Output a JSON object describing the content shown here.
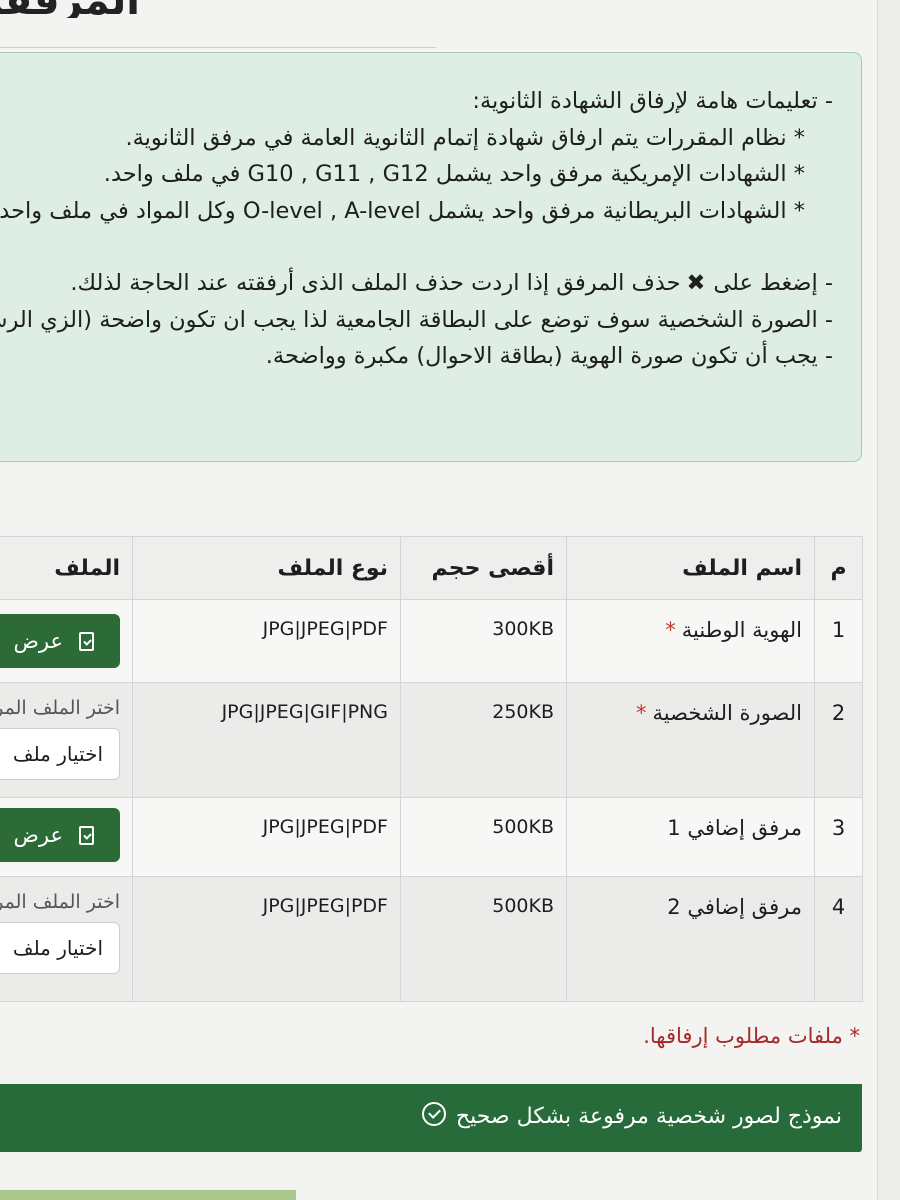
{
  "page": {
    "heading": "المرفقات"
  },
  "instructions": {
    "lines": [
      "- تعليمات هامة لإرفاق الشهادة الثانوية:",
      "* نظام المقررات يتم ارفاق شهادة إتمام الثانوية العامة في مرفق الثانوية.",
      "* الشهادات الإمريكية مرفق واحد يشمل G10 , G11 , G12 في ملف واحد.",
      "* الشهادات البريطانية مرفق واحد يشمل O-level , A-level وكل المواد في ملف واحد."
    ],
    "delete_prefix": "- إضغط على",
    "delete_text": "حذف المرفق إذا اردت حذف الملف الذى أرفقته عند الحاجة لذلك.",
    "photo_note": "- الصورة الشخصية سوف توضع على البطاقة الجامعية لذا يجب ان تكون واضحة (الزي الرسمي).",
    "id_note": "- يجب أن تكون صورة الهوية (بطاقة الاحوال) مكبرة وواضحة."
  },
  "table": {
    "headers": {
      "num": "م",
      "name": "اسم الملف",
      "max_size": "أقصى حجم",
      "type": "نوع الملف",
      "file": "الملف"
    },
    "rows": [
      {
        "num": "1",
        "name": "الهوية الوطنية",
        "required": "*",
        "max_size": "300KB",
        "type": "JPG|JPEG|PDF",
        "action": "عرض"
      },
      {
        "num": "2",
        "name": "الصورة الشخصية",
        "required": "*",
        "max_size": "250KB",
        "type": "JPG|JPEG|GIF|PNG",
        "choose_label": "اختر الملف المراد ارفاقه",
        "choose_button": "اختيار ملف"
      },
      {
        "num": "3",
        "name": "مرفق إضافي 1",
        "max_size": "500KB",
        "type": "JPG|JPEG|PDF",
        "action": "عرض"
      },
      {
        "num": "4",
        "name": "مرفق إضافي 2",
        "max_size": "500KB",
        "type": "JPG|JPEG|PDF",
        "choose_label": "اختر الملف المراد ارفاقه",
        "choose_button": "اختيار ملف"
      }
    ]
  },
  "required_note": "* ملفات مطلوب إرفاقها.",
  "sample_link": "نموذج لصور شخصية مرفوعة بشكل صحيح",
  "icons": {
    "delete": "close-x-icon",
    "view": "document-check-icon",
    "sample": "check-circle-icon"
  },
  "colors": {
    "green": "#276b3b",
    "panel": "#deeee4",
    "required": "#a42929"
  }
}
